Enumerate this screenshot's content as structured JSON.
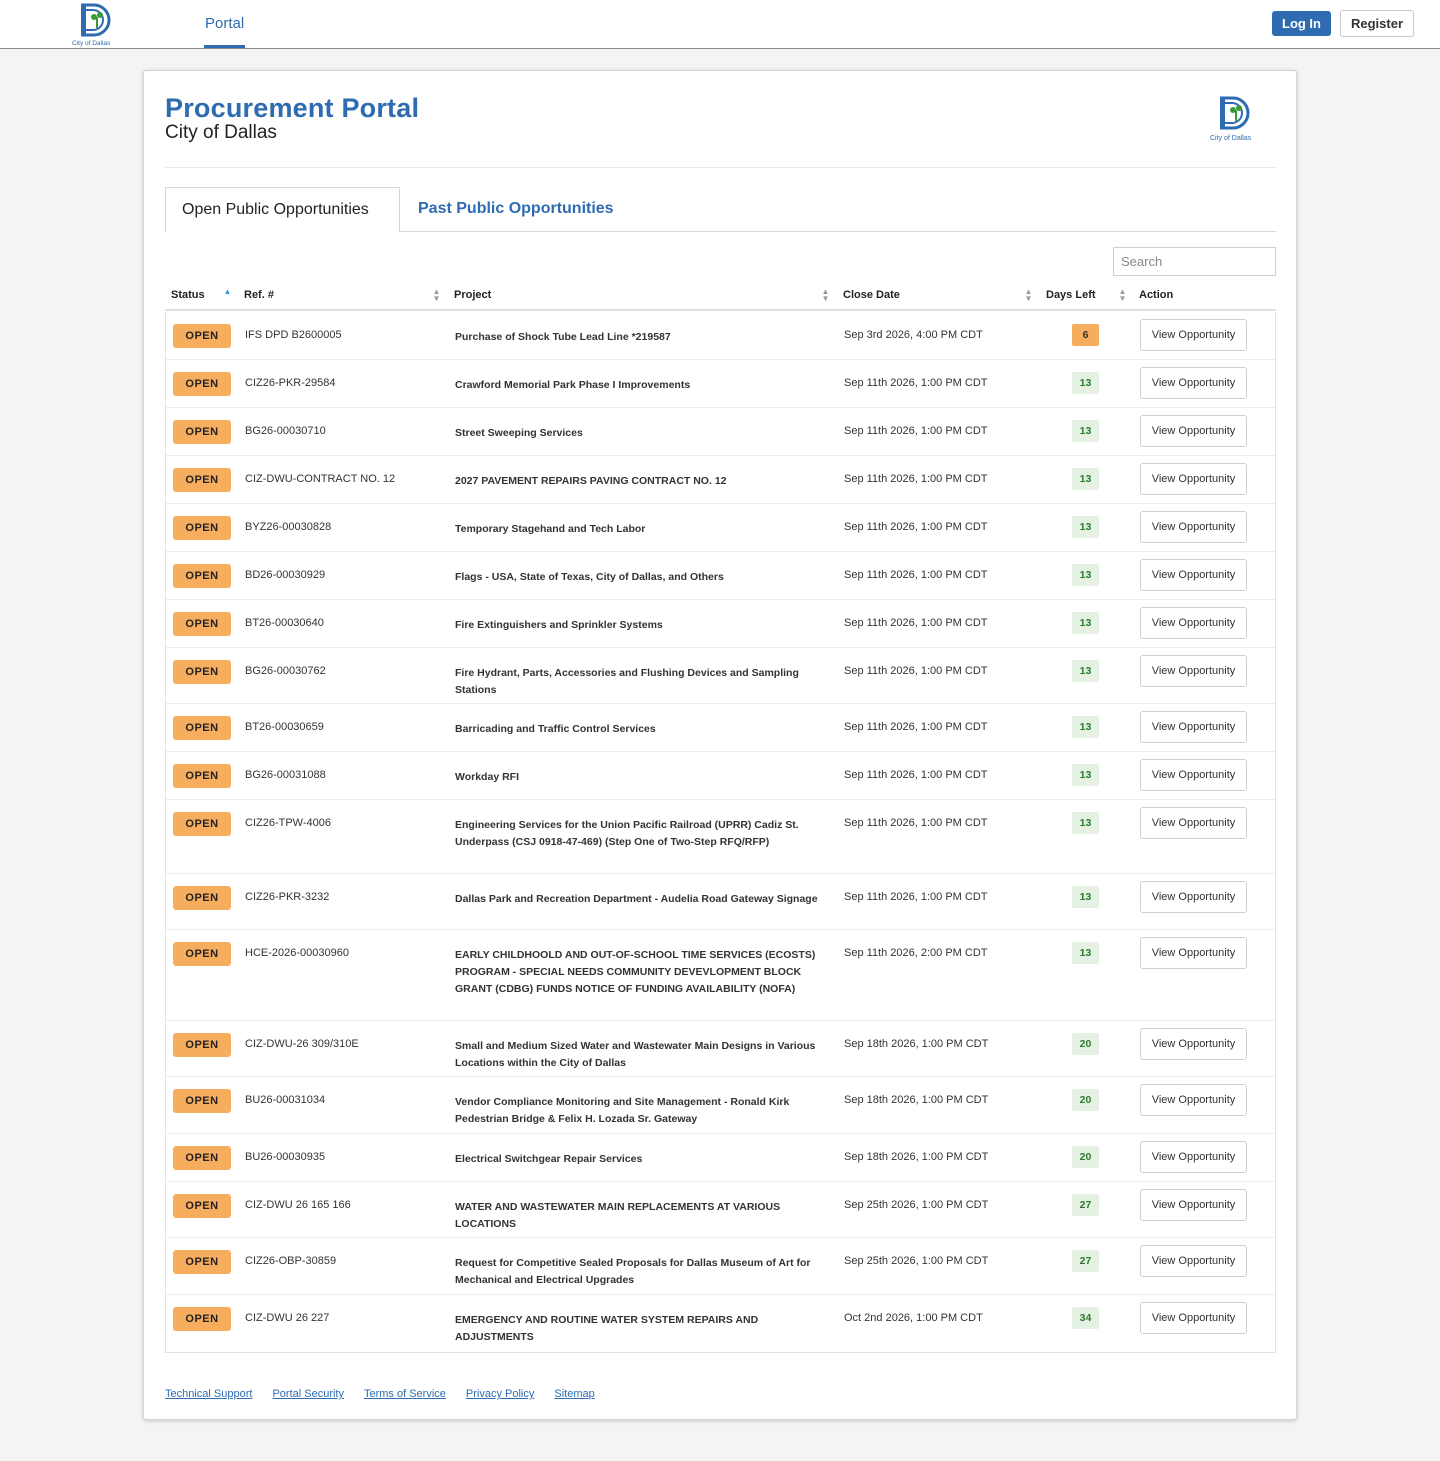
{
  "nav": {
    "tab_portal": "Portal",
    "login_label": "Log In",
    "register_label": "Register",
    "logo_text": "City of Dallas"
  },
  "header": {
    "title": "Procurement Portal",
    "subtitle": "City of Dallas",
    "logo_text": "City of Dallas"
  },
  "tabs": {
    "open": "Open Public Opportunities",
    "past": "Past Public Opportunities"
  },
  "search": {
    "placeholder": "Search"
  },
  "table": {
    "headers": {
      "status": "Status",
      "ref": "Ref. #",
      "project": "Project",
      "close_date": "Close Date",
      "days_left": "Days Left",
      "action": "Action"
    },
    "action_label": "View Opportunity",
    "rows": [
      {
        "status": "OPEN",
        "ref": "IFS DPD B2600005",
        "project": "Purchase of Shock Tube Lead Line *219587",
        "close_date": "Sep 3rd 2026, 4:00 PM CDT",
        "days_left": "6",
        "level": "warn"
      },
      {
        "status": "OPEN",
        "ref": "CIZ26-PKR-29584",
        "project": "Crawford Memorial Park Phase I Improvements",
        "close_date": "Sep 11th 2026, 1:00 PM CDT",
        "days_left": "13",
        "level": "ok"
      },
      {
        "status": "OPEN",
        "ref": "BG26-00030710",
        "project": "Street Sweeping Services",
        "close_date": "Sep 11th 2026, 1:00 PM CDT",
        "days_left": "13",
        "level": "ok"
      },
      {
        "status": "OPEN",
        "ref": "CIZ-DWU-CONTRACT NO. 12",
        "project": "2027 PAVEMENT REPAIRS PAVING CONTRACT NO. 12",
        "close_date": "Sep 11th 2026, 1:00 PM CDT",
        "days_left": "13",
        "level": "ok"
      },
      {
        "status": "OPEN",
        "ref": "BYZ26-00030828",
        "project": "Temporary Stagehand and Tech Labor",
        "close_date": "Sep 11th 2026, 1:00 PM CDT",
        "days_left": "13",
        "level": "ok"
      },
      {
        "status": "OPEN",
        "ref": "BD26-00030929",
        "project": "Flags - USA, State of Texas, City of Dallas, and Others",
        "close_date": "Sep 11th 2026, 1:00 PM CDT",
        "days_left": "13",
        "level": "ok"
      },
      {
        "status": "OPEN",
        "ref": "BT26-00030640",
        "project": "Fire Extinguishers and Sprinkler Systems",
        "close_date": "Sep 11th 2026, 1:00 PM CDT",
        "days_left": "13",
        "level": "ok"
      },
      {
        "status": "OPEN",
        "ref": "BG26-00030762",
        "project": "Fire Hydrant, Parts, Accessories and Flushing Devices and Sampling Stations",
        "close_date": "Sep 11th 2026, 1:00 PM CDT",
        "days_left": "13",
        "level": "ok"
      },
      {
        "status": "OPEN",
        "ref": "BT26-00030659",
        "project": "Barricading and Traffic Control Services",
        "close_date": "Sep 11th 2026, 1:00 PM CDT",
        "days_left": "13",
        "level": "ok"
      },
      {
        "status": "OPEN",
        "ref": "BG26-00031088",
        "project": "Workday RFI",
        "close_date": "Sep 11th 2026, 1:00 PM CDT",
        "days_left": "13",
        "level": "ok"
      },
      {
        "status": "OPEN",
        "ref": "CIZ26-TPW-4006",
        "project": "Engineering Services for the Union Pacific Railroad (UPRR) Cadiz St. Underpass (CSJ 0918-47-469) (Step One of Two-Step RFQ/RFP)",
        "close_date": "Sep 11th 2026, 1:00 PM CDT",
        "days_left": "13",
        "level": "ok"
      },
      {
        "status": "OPEN",
        "ref": "CIZ26-PKR-3232",
        "project": "Dallas Park and Recreation Department - Audelia Road Gateway Signage",
        "close_date": "Sep 11th 2026, 1:00 PM CDT",
        "days_left": "13",
        "level": "ok"
      },
      {
        "status": "OPEN",
        "ref": "HCE-2026-00030960",
        "project": "EARLY CHILDHOOLD AND OUT-OF-SCHOOL TIME SERVICES (ECOSTS) PROGRAM - SPECIAL NEEDS COMMUNITY DEVEVLOPMENT BLOCK GRANT (CDBG) FUNDS NOTICE OF FUNDING AVAILABILITY (NOFA)",
        "close_date": "Sep 11th 2026, 2:00 PM CDT",
        "days_left": "13",
        "level": "ok"
      },
      {
        "status": "OPEN",
        "ref": "CIZ-DWU-26 309/310E",
        "project": "Small and Medium Sized Water and Wastewater Main Designs in Various Locations within the City of Dallas",
        "close_date": "Sep 18th 2026, 1:00 PM CDT",
        "days_left": "20",
        "level": "ok"
      },
      {
        "status": "OPEN",
        "ref": "BU26-00031034",
        "project": "Vendor Compliance Monitoring and Site Management - Ronald Kirk Pedestrian Bridge & Felix H. Lozada Sr. Gateway",
        "close_date": "Sep 18th 2026, 1:00 PM CDT",
        "days_left": "20",
        "level": "ok"
      },
      {
        "status": "OPEN",
        "ref": "BU26-00030935",
        "project": "Electrical Switchgear Repair Services",
        "close_date": "Sep 18th 2026, 1:00 PM CDT",
        "days_left": "20",
        "level": "ok"
      },
      {
        "status": "OPEN",
        "ref": "CIZ-DWU 26 165 166",
        "project": "WATER AND WASTEWATER MAIN REPLACEMENTS AT VARIOUS LOCATIONS",
        "close_date": "Sep 25th 2026, 1:00 PM CDT",
        "days_left": "27",
        "level": "ok"
      },
      {
        "status": "OPEN",
        "ref": "CIZ26-OBP-30859",
        "project": "Request for Competitive Sealed Proposals for Dallas Museum of Art for Mechanical and Electrical Upgrades",
        "close_date": "Sep 25th 2026, 1:00 PM CDT",
        "days_left": "27",
        "level": "ok"
      },
      {
        "status": "OPEN",
        "ref": "CIZ-DWU 26 227",
        "project": "EMERGENCY AND ROUTINE WATER SYSTEM REPAIRS AND ADJUSTMENTS",
        "close_date": "Oct 2nd 2026, 1:00 PM CDT",
        "days_left": "34",
        "level": "ok"
      }
    ]
  },
  "footer": {
    "links": [
      "Technical Support",
      "Portal Security",
      "Terms of Service",
      "Privacy Policy",
      "Sitemap"
    ]
  },
  "colors": {
    "brand_blue": "#2e6bb0",
    "open_orange": "#f7ad5e",
    "days_green_bg": "#e5f2e3",
    "days_green_text": "#2b7a2b"
  }
}
